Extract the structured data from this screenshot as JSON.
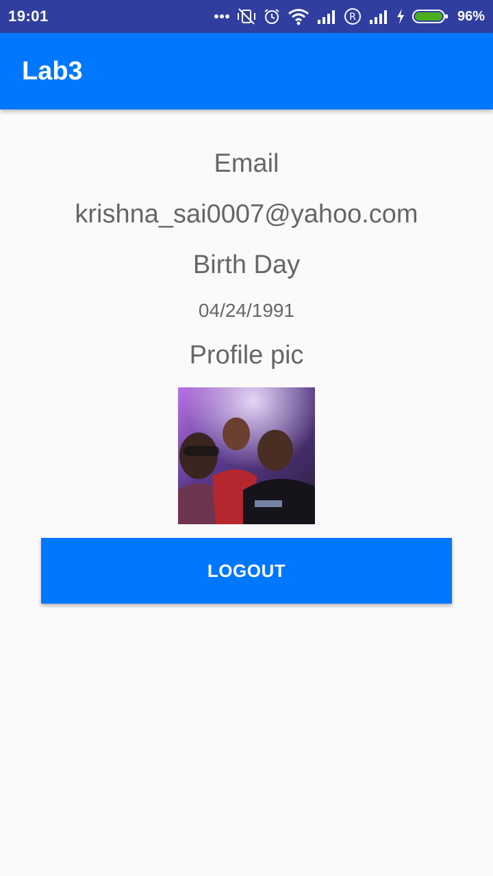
{
  "status_bar": {
    "time": "19:01",
    "battery_percent": "96%",
    "icons": [
      "more-dots-icon",
      "vibrate-off-icon",
      "alarm-icon",
      "wifi-icon",
      "signal-icon",
      "roaming-icon",
      "signal-icon",
      "charging-icon",
      "battery-icon"
    ]
  },
  "app_bar": {
    "title": "Lab3",
    "color": "#0077ff"
  },
  "profile": {
    "email_label": "Email",
    "email_value": "krishna_sai0007@yahoo.com",
    "birthday_label": "Birth Day",
    "birthday_value": "04/24/1991",
    "pic_label": "Profile pic"
  },
  "logout_label": "LOGOUT",
  "colors": {
    "status_bar": "#303f9f",
    "accent": "#0077ff",
    "text": "#666666",
    "background": "#fafafa"
  }
}
